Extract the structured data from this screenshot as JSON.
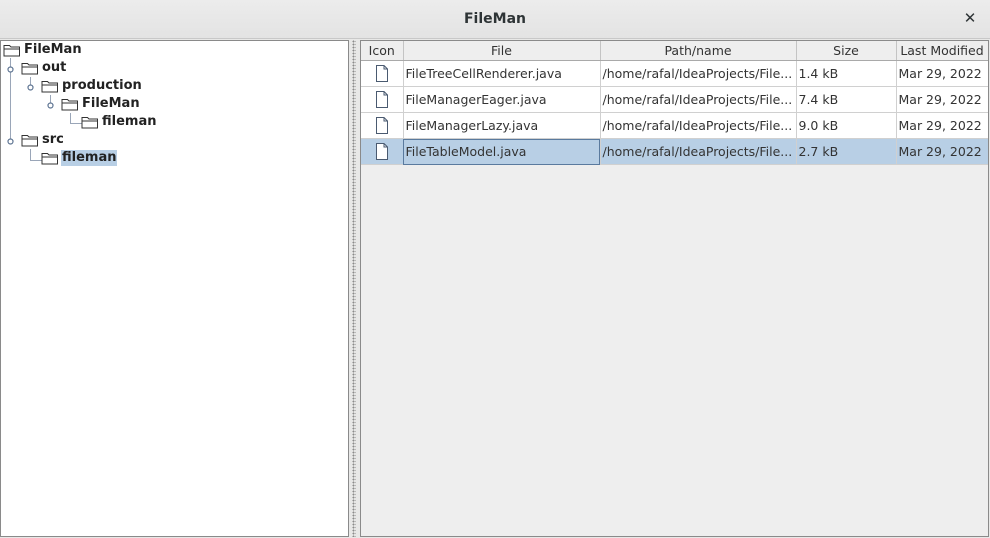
{
  "window": {
    "title": "FileMan"
  },
  "tree": {
    "nodes": [
      {
        "label": "FileMan",
        "icon": "folder-icon"
      },
      {
        "label": "out",
        "icon": "folder-icon"
      },
      {
        "label": "production",
        "icon": "folder-icon"
      },
      {
        "label": "FileMan",
        "icon": "folder-icon"
      },
      {
        "label": "fileman",
        "icon": "folder-icon"
      },
      {
        "label": "src",
        "icon": "folder-icon"
      },
      {
        "label": "fileman",
        "icon": "folder-icon",
        "selected": true
      }
    ]
  },
  "table": {
    "columns": [
      "Icon",
      "File",
      "Path/name",
      "Size",
      "Last Modified"
    ],
    "rows": [
      {
        "icon": "file-icon",
        "file": "FileTreeCellRenderer.java",
        "path": "/home/rafal/IdeaProjects/File...",
        "size": "1.4 kB",
        "modified": "Mar 29, 2022"
      },
      {
        "icon": "file-icon",
        "file": "FileManagerEager.java",
        "path": "/home/rafal/IdeaProjects/File...",
        "size": "7.4 kB",
        "modified": "Mar 29, 2022"
      },
      {
        "icon": "file-icon",
        "file": "FileManagerLazy.java",
        "path": "/home/rafal/IdeaProjects/File...",
        "size": "9.0 kB",
        "modified": "Mar 29, 2022"
      },
      {
        "icon": "file-icon",
        "file": "FileTableModel.java",
        "path": "/home/rafal/IdeaProjects/File...",
        "size": "2.7 kB",
        "modified": "Mar 29, 2022",
        "selected": true
      }
    ]
  },
  "colors": {
    "selection": "#b8cfe5",
    "panel_border": "#8a8a8a"
  }
}
